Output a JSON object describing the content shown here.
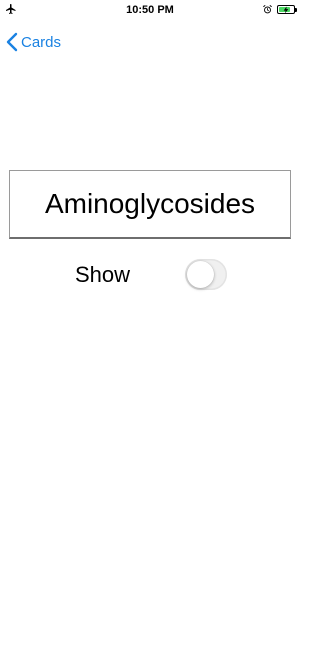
{
  "status_bar": {
    "time": "10:50 PM",
    "left_icon": "airplane-icon",
    "right_icons": [
      "alarm-icon",
      "battery-charging-icon"
    ],
    "battery_level": 0.8,
    "battery_color": "#4cd964"
  },
  "nav": {
    "back_label": "Cards",
    "back_icon": "chevron-left-icon",
    "accent_color": "#1a82e2"
  },
  "card": {
    "term": "Aminoglycosides"
  },
  "show_toggle": {
    "label": "Show",
    "checked": false
  }
}
